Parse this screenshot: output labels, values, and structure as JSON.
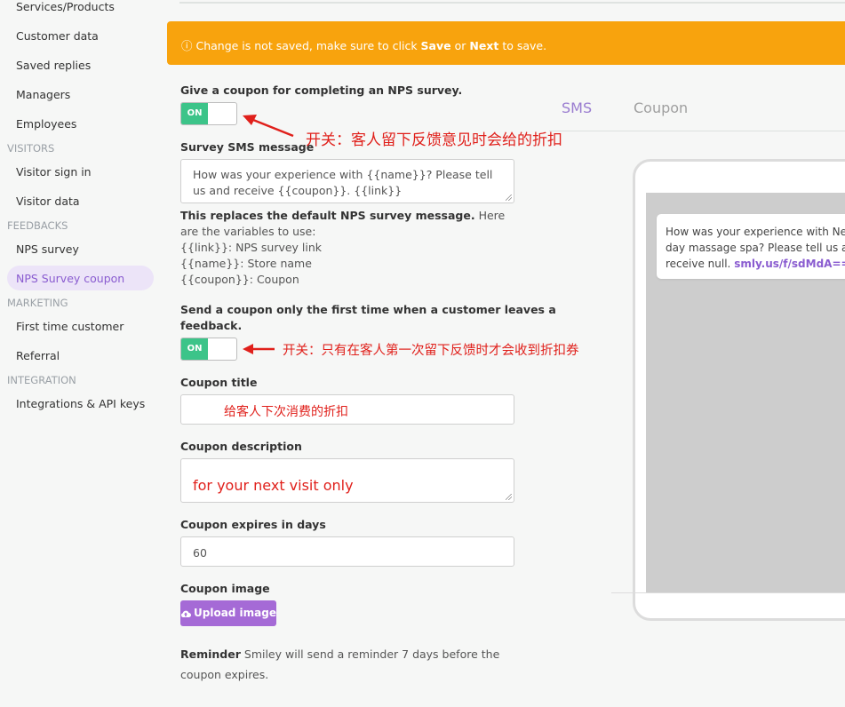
{
  "sidebar": {
    "items_top": [
      "Services/Products",
      "Customer data",
      "Saved replies",
      "Managers",
      "Employees"
    ],
    "section_visitors": "VISITORS",
    "items_visitors": [
      "Visitor sign in",
      "Visitor data"
    ],
    "section_feedbacks": "FEEDBACKS",
    "items_feedbacks": [
      "NPS survey",
      "NPS Survey coupon"
    ],
    "section_marketing": "MARKETING",
    "items_marketing": [
      "First time customer",
      "Referral"
    ],
    "section_integration": "INTEGRATION",
    "items_integration": [
      "Integrations & API keys"
    ]
  },
  "banner": {
    "prefix": "ⓘ Change is not saved, make sure to click ",
    "save": "Save",
    "or": " or ",
    "next": "Next",
    "suffix": " to save."
  },
  "form": {
    "give_coupon_label": "Give a coupon for completing an NPS survey.",
    "toggle_on": "ON",
    "survey_sms_label": "Survey SMS message",
    "survey_sms_value": "How was your experience with {{name}}? Please tell us and receive {{coupon}}. {{link}}",
    "help_bold": "This replaces the default NPS survey message.",
    "help_rest": " Here are the variables to use:",
    "help_vars": [
      "{{link}}: NPS survey link",
      "{{name}}: Store name",
      "{{coupon}}: Coupon"
    ],
    "first_time_label_1": "Send a coupon only the first time when a customer leaves a",
    "first_time_label_2": "feedback.",
    "coupon_title_label": "Coupon title",
    "coupon_title_value": "给客人下次消费的折扣",
    "coupon_desc_label": "Coupon description",
    "coupon_desc_value": "for your next visit only",
    "expires_label": "Coupon expires in days",
    "expires_value": "60",
    "image_label": "Coupon image",
    "upload_button": "Upload image",
    "reminder_bold": "Reminder",
    "reminder_text": " Smiley will send a reminder 7 days before the coupon expires."
  },
  "annotations": {
    "toggle1": "开关：客人留下反馈意见时会给的折扣",
    "toggle2": "开关：只有在客人第一次留下反馈时才会收到折扣券",
    "color": "#e0201b"
  },
  "preview": {
    "tab_sms": "SMS",
    "tab_coupon": "Coupon",
    "message_line1": "How was your experience with New",
    "message_line2": "day massage spa? Please tell us and",
    "message_line3_prefix": "receive null. ",
    "message_link": "smly.us/f/sdMdA=="
  },
  "colors": {
    "banner": "#f8a30d",
    "toggle_on": "#3cc489",
    "accent": "#a56ad6",
    "active_nav_bg": "#ece4f8"
  }
}
